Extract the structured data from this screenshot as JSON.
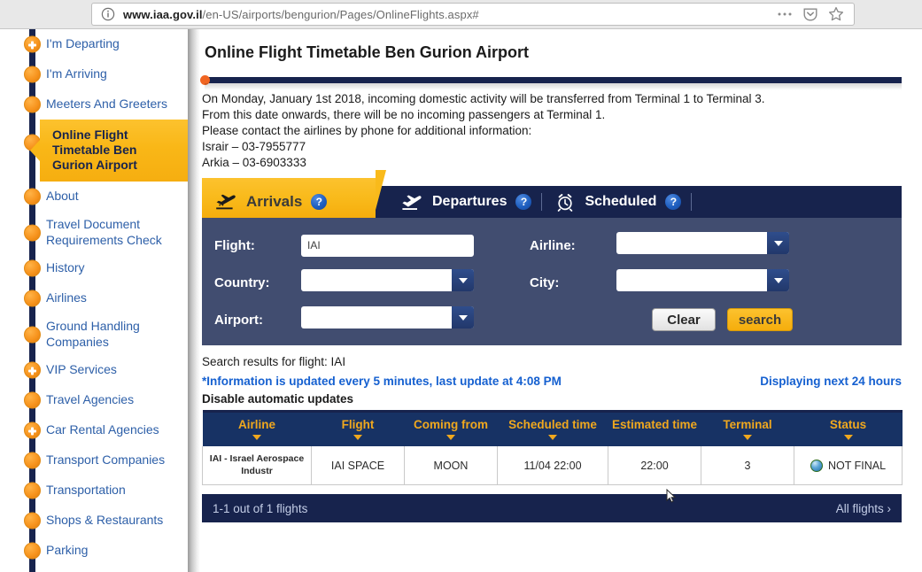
{
  "browser": {
    "url_domain": "www.iaa.gov.il",
    "url_path": "/en-US/airports/bengurion/Pages/OnlineFlights.aspx#",
    "info_icon": "info-icon",
    "menu_icon": "ellipsis-icon",
    "pocket_icon": "pocket-icon",
    "bookmark_icon": "star-icon"
  },
  "sidebar": {
    "items": [
      {
        "label": "I'm Departing",
        "marker": "plus"
      },
      {
        "label": "I'm Arriving",
        "marker": "dot"
      },
      {
        "label": "Meeters And Greeters",
        "marker": "dot"
      },
      {
        "label": "Online Flight Timetable Ben Gurion Airport",
        "marker": "dot",
        "selected": true
      },
      {
        "label": "About",
        "marker": "dot"
      },
      {
        "label": "Travel Document Requirements Check",
        "marker": "dot"
      },
      {
        "label": "History",
        "marker": "dot"
      },
      {
        "label": "Airlines",
        "marker": "dot"
      },
      {
        "label": "Ground Handling Companies",
        "marker": "dot"
      },
      {
        "label": "VIP Services",
        "marker": "plus"
      },
      {
        "label": "Travel Agencies",
        "marker": "dot"
      },
      {
        "label": "Car Rental Agencies",
        "marker": "plus"
      },
      {
        "label": "Transport Companies",
        "marker": "dot"
      },
      {
        "label": "Transportation",
        "marker": "dot"
      },
      {
        "label": "Shops & Restaurants",
        "marker": "dot"
      },
      {
        "label": "Parking",
        "marker": "dot"
      }
    ]
  },
  "main": {
    "title": "Online Flight Timetable Ben Gurion Airport",
    "notice_lines": [
      "On Monday, January 1st 2018, incoming domestic activity will be transferred from Terminal 1 to Terminal 3.",
      "From this date onwards, there will be no incoming passengers at Terminal 1.",
      "Please contact the airlines by phone for additional information:",
      "Israir – 03-7955777",
      "Arkia – 03-6903333"
    ],
    "tabs": [
      {
        "label": "Arrivals",
        "icon": "plane-landing-icon",
        "help": "?",
        "active": true
      },
      {
        "label": "Departures",
        "icon": "plane-takeoff-icon",
        "help": "?",
        "active": false
      },
      {
        "label": "Scheduled",
        "icon": "alarm-clock-icon",
        "help": "?",
        "active": false
      }
    ],
    "search_form": {
      "flight_label": "Flight:",
      "flight_value": "IAI",
      "airline_label": "Airline:",
      "airline_value": "",
      "country_label": "Country:",
      "country_value": "",
      "city_label": "City:",
      "city_value": "",
      "airport_label": "Airport:",
      "airport_value": "",
      "clear_label": "Clear",
      "search_label": "search"
    },
    "results": {
      "heading": "Search results for flight: IAI",
      "update_note": "*Information is updated every 5 minutes, last update at 4:08 PM",
      "displaying": "Displaying next 24 hours",
      "disable_updates": "Disable automatic updates",
      "columns": [
        "Airline",
        "Flight",
        "Coming from",
        "Scheduled time",
        "Estimated time",
        "Terminal",
        "Status"
      ],
      "rows": [
        {
          "airline": "IAI - Israel Aerospace Industr",
          "flight": "IAI SPACE",
          "coming_from": "MOON",
          "scheduled_time": "11/04 22:00",
          "estimated_time": "22:00",
          "terminal": "3",
          "status": "NOT FINAL",
          "status_icon": "blue-orb-icon"
        }
      ],
      "footer_count": "1-1 out of 1 flights",
      "footer_link": "All flights"
    }
  },
  "colors": {
    "navy": "#17234d",
    "gold": "#f9ba1b",
    "orange": "#f7941e",
    "link_blue": "#2d5fa8",
    "panel_slate": "#414d70",
    "header_gold_text": "#f0a81e"
  }
}
